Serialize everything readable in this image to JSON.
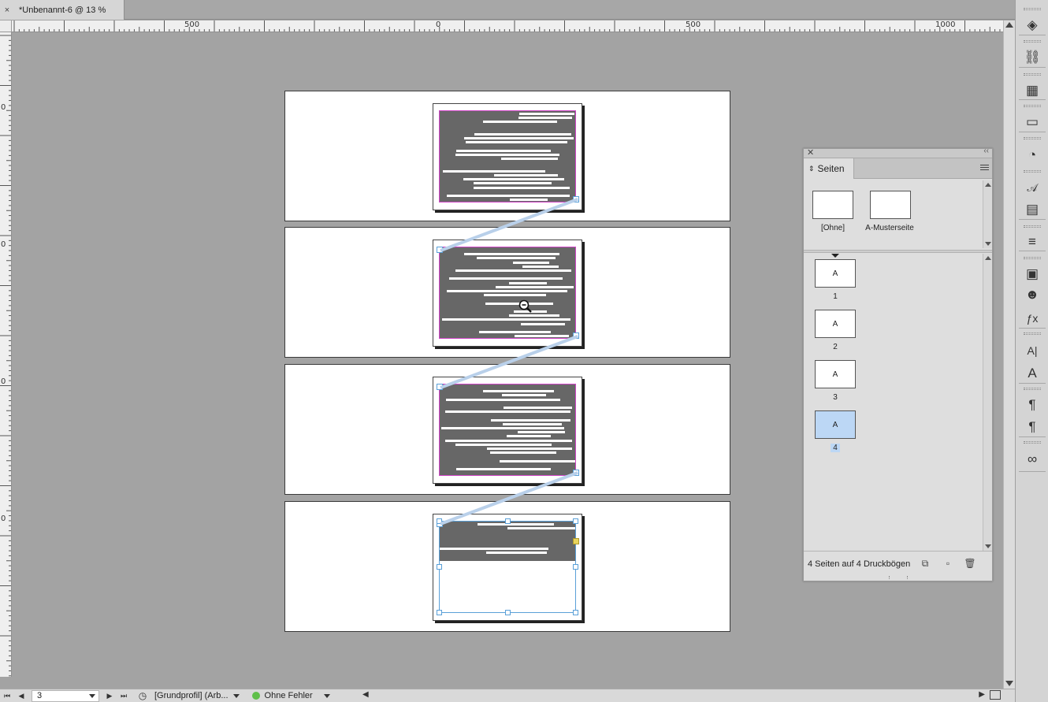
{
  "document_tab": {
    "close_glyph": "×",
    "title": "*Unbenannt-6 @ 13 %"
  },
  "ruler": {
    "horizontal_labels": [
      "500",
      "0",
      "500",
      "1000"
    ],
    "vertical_labels": [
      "0",
      "0",
      "0",
      "0"
    ]
  },
  "statusbar": {
    "page_value": "3",
    "profile": "[Grundprofil] (Arb...",
    "preflight": "Ohne Fehler"
  },
  "pages_panel": {
    "tab_label": "Seiten",
    "masters": [
      {
        "label": "[Ohne]"
      },
      {
        "label": "A-Musterseite"
      }
    ],
    "pages": [
      {
        "letter": "A",
        "number": "1",
        "selected": false
      },
      {
        "letter": "A",
        "number": "2",
        "selected": false
      },
      {
        "letter": "A",
        "number": "3",
        "selected": false
      },
      {
        "letter": "A",
        "number": "4",
        "selected": true
      }
    ],
    "footer_text": "4 Seiten auf 4 Druckbögen"
  },
  "colors": {
    "selection": "#bcd7f5",
    "margin_magenta": "#d146c9",
    "thread_blue": "#5aa0d8",
    "preflight_ok": "#5fbf49"
  },
  "toolstrip_icons": [
    "layers-icon",
    "links-icon",
    "swatches-icon",
    "gradient-icon",
    "color-theme-icon",
    "character-styles-icon",
    "text-wrap-icon",
    "stroke-icon",
    "story-icon",
    "cc-libraries-icon",
    "effects-icon",
    "character-icon",
    "character-styles-panel-icon",
    "paragraph-icon",
    "paragraph-styles-icon",
    "creative-cloud-icon"
  ]
}
